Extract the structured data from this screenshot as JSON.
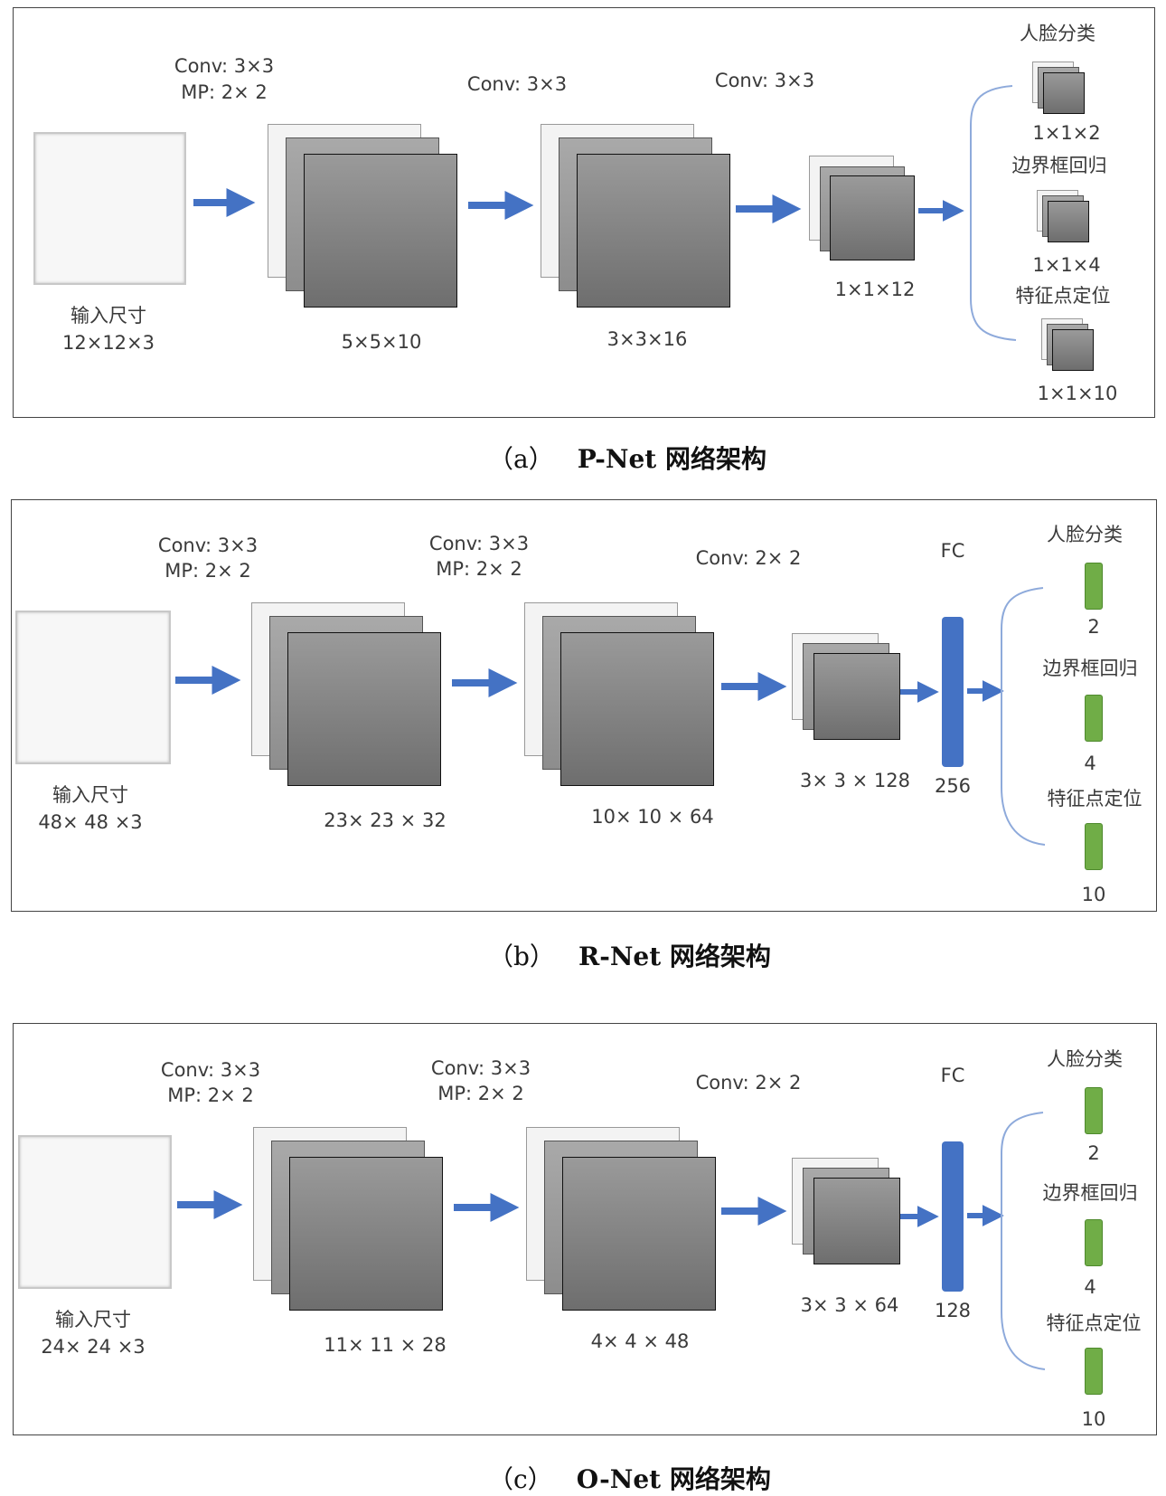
{
  "panels": {
    "a": {
      "caption_prefix": "（a）",
      "caption_name": "P-Net 网络架构",
      "input_label": "输入尺寸",
      "input_size": "12×12×3",
      "op1": "Conv: 3×3",
      "op1b": "MP: 2× 2",
      "op2": "Conv: 3×3",
      "op3": "Conv: 3×3",
      "fm1": "5×5×10",
      "fm2": "3×3×16",
      "fm3": "1×1×12",
      "out1_title": "人脸分类",
      "out1_size": "1×1×2",
      "out2_title": "边界框回归",
      "out2_size": "1×1×4",
      "out3_title": "特征点定位",
      "out3_size": "1×1×10"
    },
    "b": {
      "caption_prefix": "（b）",
      "caption_name": "R-Net 网络架构",
      "input_label": "输入尺寸",
      "input_size": "48× 48 ×3",
      "op1": "Conv: 3×3",
      "op1b": "MP: 2× 2",
      "op2": "Conv: 3×3",
      "op2b": "MP: 2× 2",
      "op3": "Conv: 2× 2",
      "fm1": "23× 23 × 32",
      "fm2": "10× 10 × 64",
      "fm3": "3× 3 × 128",
      "fc_label": "FC",
      "fc_size": "256",
      "out1_title": "人脸分类",
      "out1_size": "2",
      "out2_title": "边界框回归",
      "out2_size": "4",
      "out3_title": "特征点定位",
      "out3_size": "10"
    },
    "c": {
      "caption_prefix": "（c）",
      "caption_name": "O-Net 网络架构",
      "input_label": "输入尺寸",
      "input_size": "24× 24 ×3",
      "op1": "Conv: 3×3",
      "op1b": "MP: 2× 2",
      "op2": "Conv: 3×3",
      "op2b": "MP: 2× 2",
      "op3": "Conv: 2× 2",
      "fm1": "11× 11 × 28",
      "fm2": "4× 4 × 48",
      "fm3": "3× 3 × 64",
      "fc_label": "FC",
      "fc_size": "128",
      "out1_title": "人脸分类",
      "out1_size": "2",
      "out2_title": "边界框回归",
      "out2_size": "4",
      "out3_title": "特征点定位",
      "out3_size": "10"
    }
  },
  "colors": {
    "arrow": "#4472c4",
    "fc_bar": "#4472c4",
    "output_bar": "#70ad47",
    "brace": "#8eaadb"
  }
}
